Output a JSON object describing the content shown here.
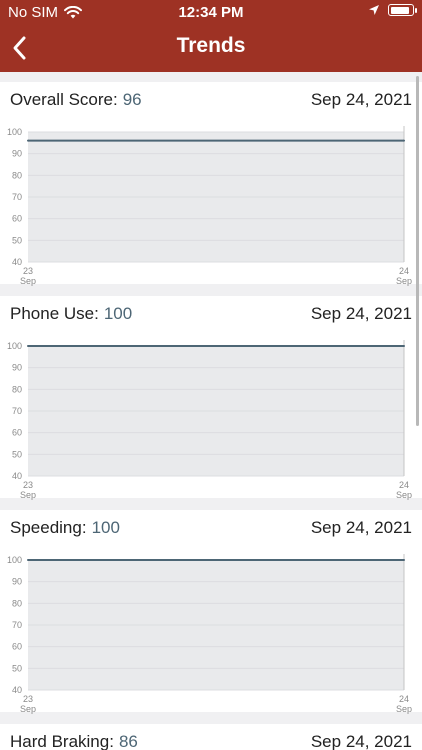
{
  "status": {
    "carrier": "No SIM",
    "time": "12:34 PM",
    "battery_level": 0.9
  },
  "nav": {
    "title": "Trends"
  },
  "colors": {
    "header": "#9e3224",
    "line": "#4d6675",
    "plot_bg": "#e9eaec"
  },
  "cards": [
    {
      "label": "Overall Score:",
      "value": "96",
      "date": "Sep 24, 2021"
    },
    {
      "label": "Phone Use:",
      "value": "100",
      "date": "Sep 24, 2021"
    },
    {
      "label": "Speeding:",
      "value": "100",
      "date": "Sep 24, 2021"
    },
    {
      "label": "Hard Braking:",
      "value": "86",
      "date": "Sep 24, 2021"
    }
  ],
  "chart_data": [
    {
      "type": "line",
      "x": [
        "23 Sep",
        "24 Sep"
      ],
      "y": [
        96,
        96
      ],
      "ylim": [
        40,
        100
      ],
      "yticks": [
        100,
        90,
        80,
        70,
        60,
        50,
        40
      ],
      "xticks": [
        [
          "23",
          "Sep"
        ],
        [
          "24",
          "Sep"
        ]
      ],
      "grid": true
    },
    {
      "type": "line",
      "x": [
        "23 Sep",
        "24 Sep"
      ],
      "y": [
        100,
        100
      ],
      "ylim": [
        40,
        100
      ],
      "yticks": [
        100,
        90,
        80,
        70,
        60,
        50,
        40
      ],
      "xticks": [
        [
          "23",
          "Sep"
        ],
        [
          "24",
          "Sep"
        ]
      ],
      "grid": true
    },
    {
      "type": "line",
      "x": [
        "23 Sep",
        "24 Sep"
      ],
      "y": [
        100,
        100
      ],
      "ylim": [
        40,
        100
      ],
      "yticks": [
        100,
        90,
        80,
        70,
        60,
        50,
        40
      ],
      "xticks": [
        [
          "23",
          "Sep"
        ],
        [
          "24",
          "Sep"
        ]
      ],
      "grid": true
    }
  ]
}
